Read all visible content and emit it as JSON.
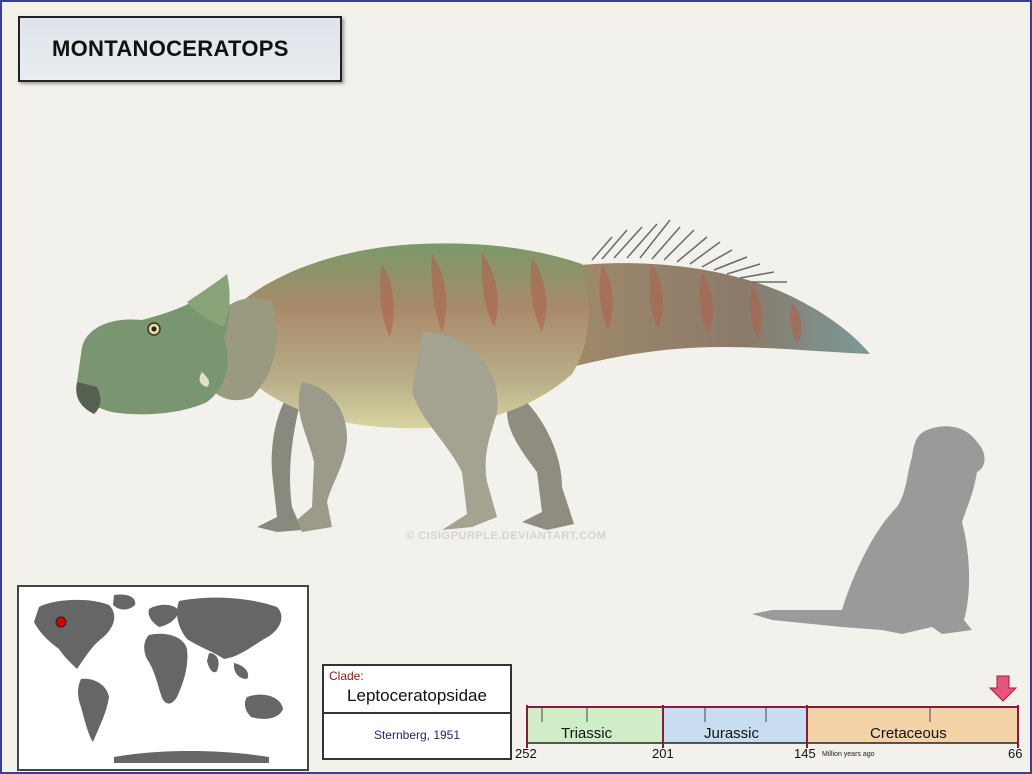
{
  "title": "MONTANOCERATOPS",
  "watermark": "© CISIGPURPLE.DEVIANTART.COM",
  "map": {
    "marker_color": "#d40000",
    "land_color": "#666666"
  },
  "clade": {
    "label": "Clade:",
    "name": "Leptoceratopsidae",
    "author": "Sternberg, 1951"
  },
  "timeline": {
    "periods": [
      {
        "name": "Triassic",
        "color": "#cfeec8"
      },
      {
        "name": "Jurassic",
        "color": "#c9ddf0"
      },
      {
        "name": "Cretaceous",
        "color": "#f5d3a8"
      }
    ],
    "ticks": [
      "252",
      "201",
      "145",
      "66"
    ],
    "unit": "Million years ago",
    "arrow_color": "#e8557a"
  },
  "colors": {
    "frame": "#3a3f9a",
    "background": "#f3f1ec"
  }
}
